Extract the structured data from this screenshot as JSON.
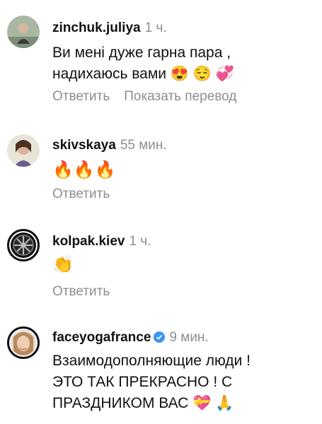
{
  "comments": [
    {
      "username": "zinchuk.juliya",
      "time": "1 ч.",
      "text_line1": "Ви мені дуже гарна пара ,",
      "text_line2": "надихаюсь вами 😍 😌 💞",
      "reply_label": "Ответить",
      "translate_label": "Показать перевод",
      "avatar_icon": "user-photo"
    },
    {
      "username": "skivskaya",
      "time": "55 мин.",
      "text": "🔥🔥🔥",
      "reply_label": "Ответить",
      "avatar_icon": "user-photo"
    },
    {
      "username": "kolpak.kiev",
      "time": "1 ч.",
      "text": "👏",
      "reply_label": "Ответить",
      "avatar_icon": "car-wheel-logo"
    },
    {
      "username": "faceyogafrance",
      "time": "9 мин.",
      "verified": true,
      "text_line1": "Взаимодополняющие люди !",
      "text_line2": "ЭТО ТАК ПРЕКРАСНО ! С",
      "text_line3": "ПРАЗДНИКОМ ВАС 💝 🙏",
      "avatar_icon": "user-photo"
    }
  ],
  "colors": {
    "text": "#111111",
    "muted": "#8e8e8e",
    "verified": "#3897f0"
  }
}
